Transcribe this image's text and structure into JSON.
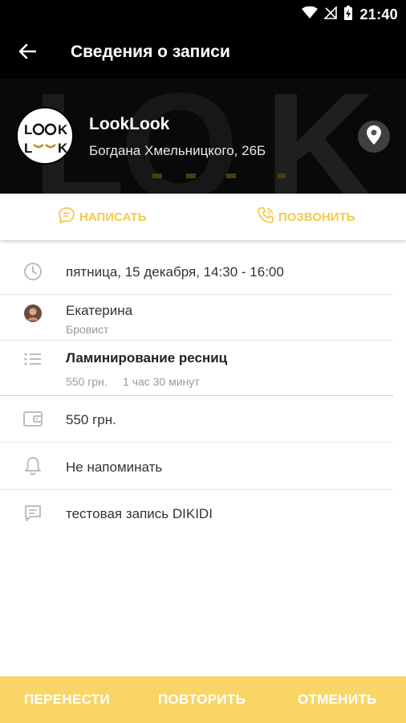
{
  "status_bar": {
    "time": "21:40",
    "icons": [
      "wifi-icon",
      "no-signal-icon",
      "battery-charging-icon"
    ]
  },
  "header": {
    "title": "Сведения о записи",
    "back_icon": "arrow-left-icon"
  },
  "salon": {
    "name": "LookLook",
    "address": "Богдана Хмельницкого, 26Б",
    "map_icon": "location-pin-icon",
    "logo_text": "LOOK LOOK"
  },
  "actions": {
    "write_label": "НАПИСАТЬ",
    "call_label": "ПОЗВОНИТЬ",
    "accent": "#f7c948"
  },
  "details": {
    "datetime": "пятница, 15 декабря, 14:30 - 16:00",
    "master_name": "Екатерина",
    "master_role": "Бровист",
    "service_name": "Ламинирование ресниц",
    "service_price": "550 грн.",
    "service_duration": "1 час 30 минут",
    "total": "550 грн.",
    "reminder": "Не напоминать",
    "comment": "тестовая запись DIKIDI"
  },
  "bottom_actions": {
    "move_label": "ПЕРЕНЕСТИ",
    "repeat_label": "ПОВТОРИТЬ",
    "cancel_label": "ОТМЕНИТЬ",
    "bar_color": "#f9d566"
  }
}
